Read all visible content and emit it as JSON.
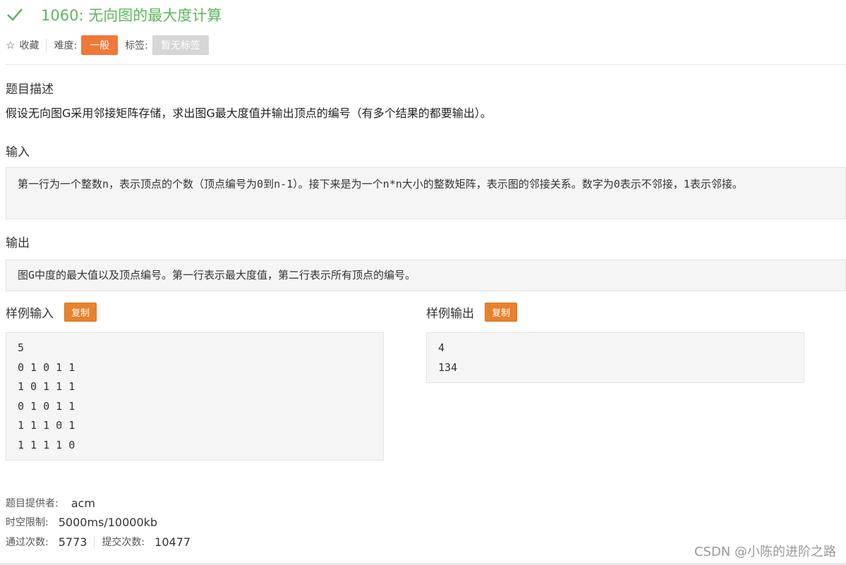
{
  "problem": {
    "title": "1060: 无向图的最大度计算"
  },
  "meta": {
    "favorite_label": "收藏",
    "difficulty_label": "难度:",
    "difficulty_value": "一般",
    "tags_label": "标签:",
    "tags_value": "暂无标签"
  },
  "sections": {
    "description_heading": "题目描述",
    "description_text": "假设无向图G采用邻接矩阵存储，求出图G最大度值并输出顶点的编号（有多个结果的都要输出）。",
    "input_heading": "输入",
    "input_text": "第一行为一个整数n，表示顶点的个数（顶点编号为0到n-1）。接下来是为一个n*n大小的整数矩阵，表示图的邻接关系。数字为0表示不邻接，1表示邻接。",
    "output_heading": "输出",
    "output_text": "图G中度的最大值以及顶点编号。第一行表示最大度值，第二行表示所有顶点的编号。"
  },
  "samples": {
    "input_heading": "样例输入",
    "output_heading": "样例输出",
    "copy_label": "复制",
    "input_lines": [
      "5",
      "0 1 0 1 1",
      "1 0 1 1 1",
      "0 1 0 1 1",
      "1 1 1 0 1",
      "1 1 1 1 0"
    ],
    "output_lines": [
      "4",
      "134"
    ]
  },
  "info": {
    "provider_label": "题目提供者:",
    "provider_value": "acm",
    "limit_label": "时空限制:",
    "limit_value": "5000ms/10000kb",
    "passed_label": "通过次数:",
    "passed_value": "5773",
    "submitted_label": "提交次数:",
    "submitted_value": "10477"
  },
  "watermark": "CSDN @小陈的进阶之路",
  "colors": {
    "title_green": "#5cb85c",
    "difficulty_orange": "#f0793a",
    "copy_orange": "#e8822c"
  }
}
